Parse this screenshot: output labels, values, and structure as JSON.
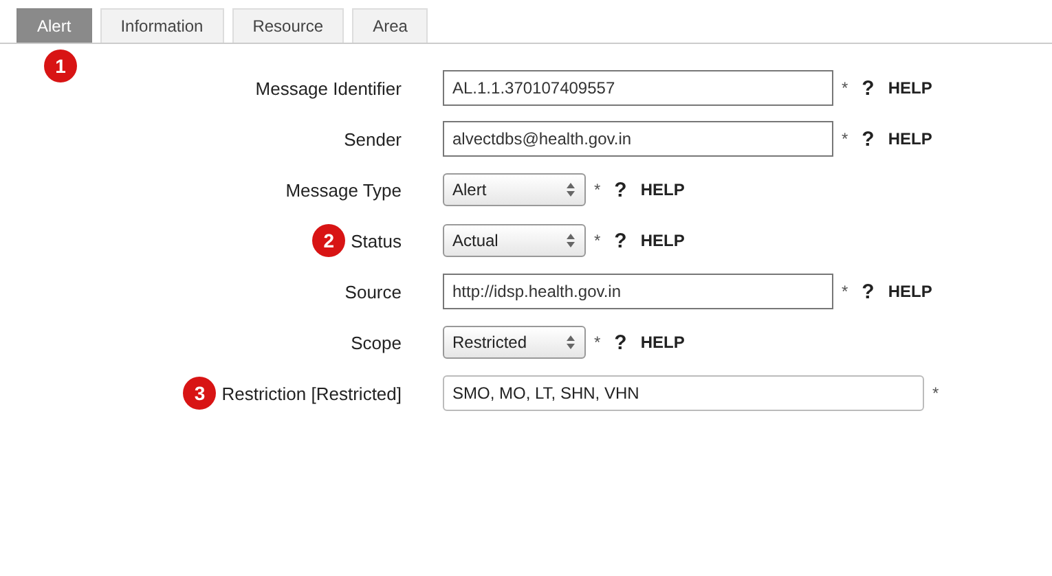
{
  "tabs": [
    {
      "label": "Alert",
      "selected": true
    },
    {
      "label": "Information",
      "selected": false
    },
    {
      "label": "Resource",
      "selected": false
    },
    {
      "label": "Area",
      "selected": false
    }
  ],
  "tab_badge": "1",
  "fields": [
    {
      "label": "Message Identifier",
      "kind": "text",
      "value": "AL.1.1.370107409557",
      "required": "*",
      "help_mark": "?",
      "help": "HELP"
    },
    {
      "label": "Sender",
      "kind": "text",
      "value": "alvectdbs@health.gov.in",
      "required": "*",
      "help_mark": "?",
      "help": "HELP"
    },
    {
      "label": "Message Type",
      "kind": "select",
      "value": "Alert",
      "required": "*",
      "help_mark": "?",
      "help": "HELP"
    },
    {
      "label": "Status",
      "kind": "select",
      "value": "Actual",
      "required": "*",
      "help_mark": "?",
      "help": "HELP",
      "badge": "2"
    },
    {
      "label": "Source",
      "kind": "text",
      "value": "http://idsp.health.gov.in",
      "required": "*",
      "help_mark": "?",
      "help": "HELP"
    },
    {
      "label": "Scope",
      "kind": "select",
      "value": "Restricted",
      "required": "*",
      "help_mark": "?",
      "help": "HELP"
    },
    {
      "label": "Restriction [Restricted]",
      "kind": "multiselect",
      "value": "SMO, MO, LT, SHN, VHN",
      "required": "*",
      "badge": "3"
    }
  ]
}
